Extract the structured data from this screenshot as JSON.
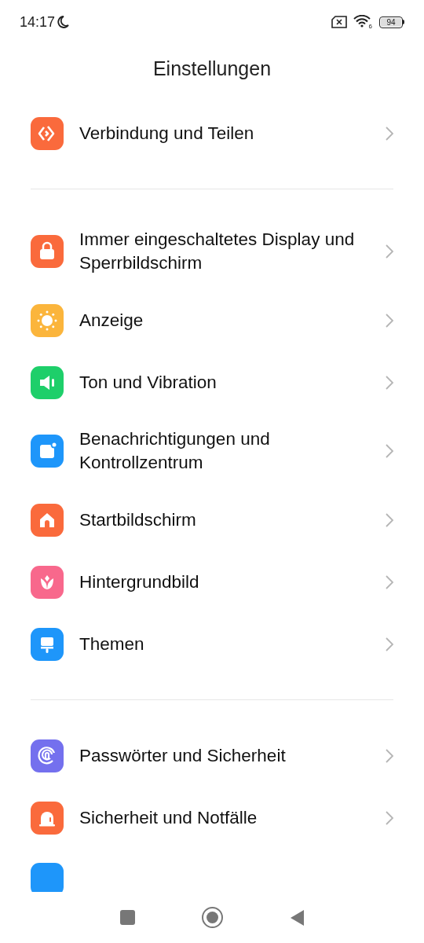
{
  "status_bar": {
    "time": "14:17",
    "battery": "94",
    "wifi_band": "6"
  },
  "title": "Einstellungen",
  "groups": [
    [
      {
        "label": "Verbindung und Teilen",
        "kind": "share",
        "color": "#fa6a3c"
      }
    ],
    [
      {
        "label": "Immer eingeschaltetes Display und Sperrbildschirm",
        "kind": "lock",
        "color": "#fa6a3c"
      },
      {
        "label": "Anzeige",
        "kind": "sun",
        "color": "#fbb53c"
      },
      {
        "label": "Ton und Vibration",
        "kind": "speaker",
        "color": "#1ecf6a"
      },
      {
        "label": "Benachrichtigungen und Kontrollzentrum",
        "kind": "notification",
        "color": "#1e96fa"
      },
      {
        "label": "Startbildschirm",
        "kind": "home",
        "color": "#fa6a3c"
      },
      {
        "label": "Hintergrundbild",
        "kind": "flower",
        "color": "#f8688c"
      },
      {
        "label": "Themen",
        "kind": "brush",
        "color": "#1e96fa"
      }
    ],
    [
      {
        "label": "Passwörter und Sicherheit",
        "kind": "fingerprint",
        "color": "#7470ee"
      },
      {
        "label": "Sicherheit und Notfälle",
        "kind": "siren",
        "color": "#fa6a3c"
      }
    ]
  ],
  "cut_off_item": {
    "color": "#1e96fa"
  }
}
